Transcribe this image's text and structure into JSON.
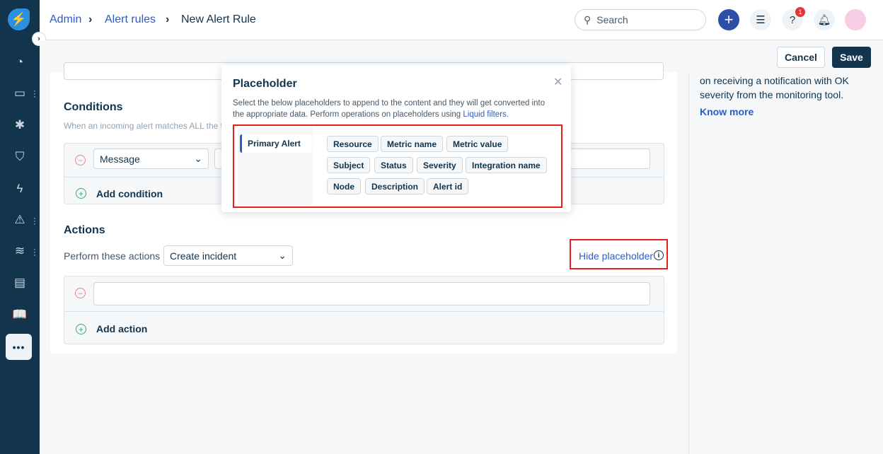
{
  "sidebar": {
    "items": [
      {
        "icon": "dashboard-icon"
      },
      {
        "icon": "ticket-icon",
        "has_menu": true
      },
      {
        "icon": "bug-icon"
      },
      {
        "icon": "shield-icon"
      },
      {
        "icon": "alert-bolt-icon"
      },
      {
        "icon": "warning-icon",
        "has_menu": true
      },
      {
        "icon": "layers-icon",
        "has_menu": true
      },
      {
        "icon": "document-icon"
      },
      {
        "icon": "book-icon"
      },
      {
        "icon": "more-icon"
      }
    ]
  },
  "header": {
    "breadcrumb": [
      "Admin",
      "Alert rules",
      "New Alert Rule"
    ],
    "search_placeholder": "Search",
    "help_badge": "1"
  },
  "toolbar": {
    "cancel": "Cancel",
    "save": "Save"
  },
  "right_panel": {
    "line1": "on receiving a notification with OK",
    "line2": "severity from the monitoring tool.",
    "know_more": "Know more"
  },
  "conditions": {
    "title": "Conditions",
    "description": "When an incoming alert matches ALL the f",
    "field": "Message",
    "add": "Add condition"
  },
  "actions": {
    "title": "Actions",
    "label": "Perform these actions",
    "action": "Create incident",
    "add": "Add action",
    "hide_placeholder": "Hide placeholder"
  },
  "modal": {
    "title": "Placeholder",
    "desc1": "Select the below placeholders to append to the content and they will get converted into",
    "desc2": "the appropriate data. Perform operations on placeholders using ",
    "liquid": "Liquid filters.",
    "tab": "Primary Alert",
    "chips": [
      "Resource",
      "Metric name",
      "Metric value",
      "Subject",
      "Status",
      "Severity",
      "Integration name",
      "Node",
      "Description",
      "Alert id"
    ]
  },
  "colors": {
    "sidebar": "#12344d",
    "accent": "#2c5cc5",
    "highlight": "#e8201a"
  }
}
